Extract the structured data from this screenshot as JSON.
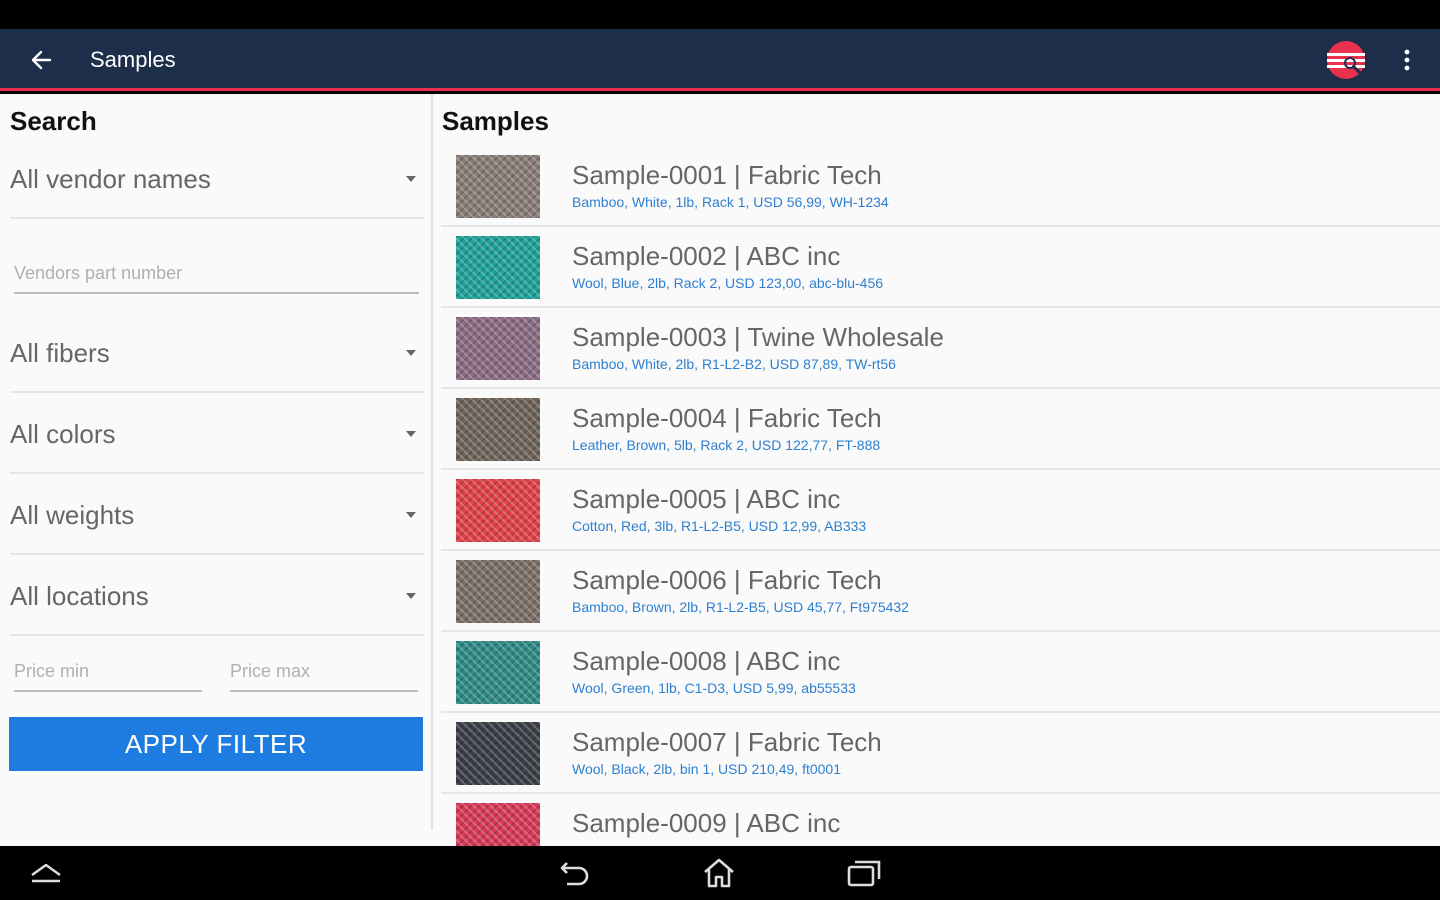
{
  "app_bar": {
    "title": "Samples"
  },
  "search": {
    "title": "Search",
    "vendor_dropdown": "All vendor names",
    "part_number_placeholder": "Vendors part number",
    "fibers_dropdown": "All fibers",
    "colors_dropdown": "All colors",
    "weights_dropdown": "All weights",
    "locations_dropdown": "All locations",
    "price_min_placeholder": "Price min",
    "price_max_placeholder": "Price max",
    "apply_label": "APPLY FILTER"
  },
  "samples": {
    "title": "Samples",
    "items": [
      {
        "title": "Sample-0001 | Fabric Tech",
        "details": "Bamboo, White, 1lb, Rack 1, USD 56,99, WH-1234",
        "swatch": "#8a7e78"
      },
      {
        "title": "Sample-0002 | ABC inc",
        "details": "Wool, Blue, 2lb, Rack 2, USD 123,00, abc-blu-456",
        "swatch": "#1fa39a"
      },
      {
        "title": "Sample-0003 | Twine Wholesale",
        "details": "Bamboo, White, 2lb, R1-L2-B2, USD 87,89, TW-rt56",
        "swatch": "#8c6d84"
      },
      {
        "title": "Sample-0004 | Fabric Tech",
        "details": "Leather, Brown, 5lb, Rack 2, USD 122,77, FT-888",
        "swatch": "#6f6459"
      },
      {
        "title": "Sample-0005 | ABC inc",
        "details": "Cotton, Red, 3lb, R1-L2-B5, USD 12,99, AB333",
        "swatch": "#e2434a"
      },
      {
        "title": "Sample-0006 | Fabric Tech",
        "details": "Bamboo, Brown, 2lb, R1-L2-B5, USD 45,77, Ft975432",
        "swatch": "#7c7068"
      },
      {
        "title": "Sample-0008 | ABC inc",
        "details": "Wool, Green, 1lb, C1-D3, USD 5,99, ab55533",
        "swatch": "#2e8b86"
      },
      {
        "title": "Sample-0007 | Fabric Tech",
        "details": "Wool, Black, 2lb, bin 1, USD 210,49, ft0001",
        "swatch": "#3c3f48"
      },
      {
        "title": "Sample-0009 | ABC inc",
        "details": "",
        "swatch": "#d93a58"
      }
    ]
  },
  "colors": {
    "app_bar": "#1c2e4a",
    "accent": "#e8304f",
    "primary_button": "#1e7ce0",
    "link": "#2e7fd0"
  },
  "icons": {
    "back": "arrow-left-icon",
    "menu": "more-vert-icon",
    "logo": "fabric-logo-icon",
    "nav_hide": "hide-keyboard-icon",
    "nav_back": "undo-arrow-icon",
    "nav_home": "home-icon",
    "nav_recent": "recent-apps-icon"
  }
}
